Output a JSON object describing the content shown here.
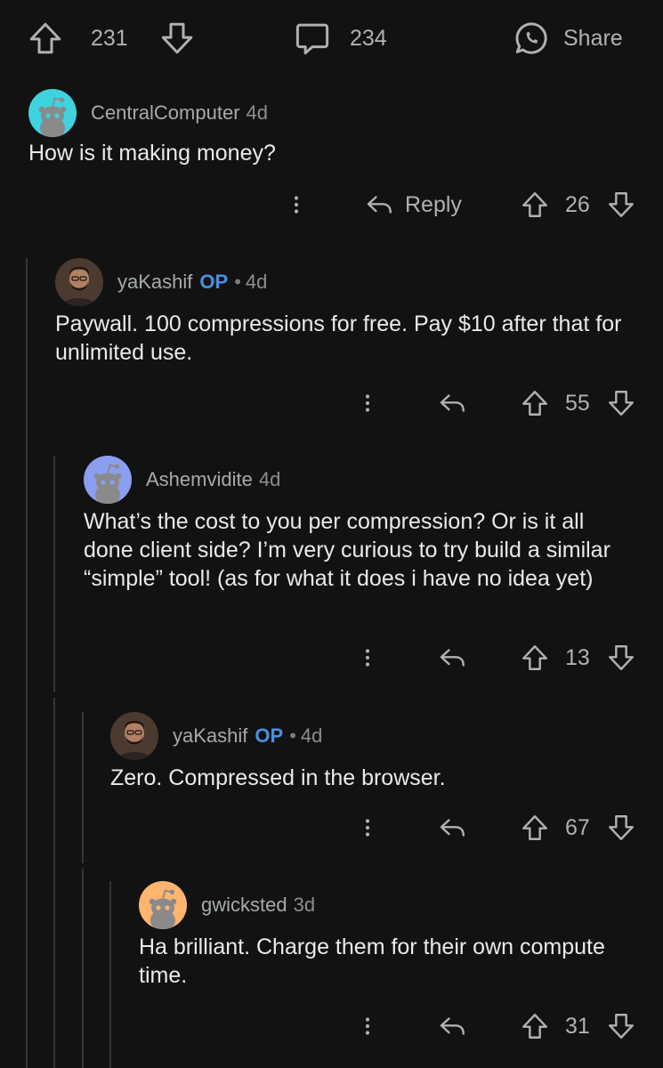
{
  "post_bar": {
    "upvotes": "231",
    "comments": "234",
    "share_label": "Share"
  },
  "comments": [
    {
      "author": "CentralComputer",
      "is_op": false,
      "age": "4d",
      "body": "How is it making money?",
      "reply_label": "Reply",
      "score": "26",
      "avatar": "snoo-teal"
    },
    {
      "author": "yaKashif",
      "is_op": true,
      "op_label": "OP",
      "separator": "•",
      "age": "4d",
      "body": "Paywall. 100 compressions for free. Pay $10 after that for unlimited use.",
      "score": "55",
      "avatar": "user-photo"
    },
    {
      "author": "Ashemvidite",
      "is_op": false,
      "age": "4d",
      "body": "What’s the cost to you per compression? Or is it all done client side? I’m very curious to try build a similar “simple” tool! (as for what it does i have no idea yet)",
      "score": "13",
      "avatar": "snoo-periwinkle"
    },
    {
      "author": "yaKashif",
      "is_op": true,
      "op_label": "OP",
      "separator": "•",
      "age": "4d",
      "body": "Zero. Compressed in the browser.",
      "score": "67",
      "avatar": "user-photo"
    },
    {
      "author": "gwicksted",
      "is_op": false,
      "age": "3d",
      "body": "Ha brilliant. Charge them for their own compute time.",
      "score": "31",
      "avatar": "snoo-orange"
    }
  ],
  "colors": {
    "background": "#121212",
    "text": "#e8eaec",
    "muted": "#aeb2b5",
    "op": "#4a90e2",
    "thread_line": "#343536",
    "snoo_teal": "#3fd3df",
    "snoo_periwinkle": "#8b9ff0",
    "snoo_orange": "#ffb470"
  }
}
